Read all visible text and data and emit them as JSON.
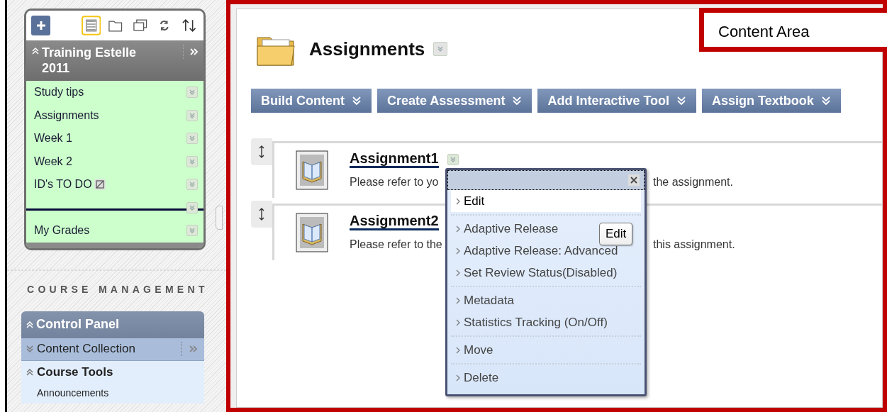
{
  "course_menu": {
    "title": "Training Estelle 2011",
    "items": [
      {
        "kind": "link",
        "label": "Study tips",
        "hidden": false
      },
      {
        "kind": "link",
        "label": "Assignments",
        "hidden": false
      },
      {
        "kind": "link",
        "label": "Week 1",
        "hidden": false
      },
      {
        "kind": "link",
        "label": "Week 2",
        "hidden": false
      },
      {
        "kind": "link",
        "label": "ID's TO DO",
        "hidden": true
      },
      {
        "kind": "divider"
      },
      {
        "kind": "link",
        "label": "My Grades",
        "hidden": false
      }
    ]
  },
  "course_management": {
    "heading": "COURSE MANAGEMENT",
    "panel_title": "Control Panel",
    "sections": [
      {
        "label": "Content Collection",
        "expanded": false
      },
      {
        "label": "Course Tools",
        "expanded": true,
        "links": [
          "Announcements"
        ]
      }
    ]
  },
  "content": {
    "title": "Assignments",
    "actions": [
      "Build Content",
      "Create Assessment",
      "Add Interactive Tool",
      "Assign Textbook"
    ],
    "items": [
      {
        "title": "Assignment1",
        "description_start": "Please refer to yo",
        "description_end": "the assignment."
      },
      {
        "title": "Assignment2",
        "description_start": "Please refer to the",
        "description_end": "this assignment."
      }
    ]
  },
  "context_menu": {
    "groups": [
      [
        {
          "label": "Edit",
          "selected": true
        }
      ],
      [
        {
          "label": "Adaptive Release",
          "selected": false
        },
        {
          "label": "Adaptive Release: Advanced",
          "selected": false
        },
        {
          "label": "Set Review Status(Disabled)",
          "selected": false
        }
      ],
      [
        {
          "label": "Metadata",
          "selected": false
        },
        {
          "label": "Statistics Tracking (On/Off)",
          "selected": false
        }
      ],
      [
        {
          "label": "Move",
          "selected": false
        }
      ],
      [
        {
          "label": "Delete",
          "selected": false
        }
      ]
    ],
    "tooltip": "Edit"
  },
  "annotation": "Content Area"
}
